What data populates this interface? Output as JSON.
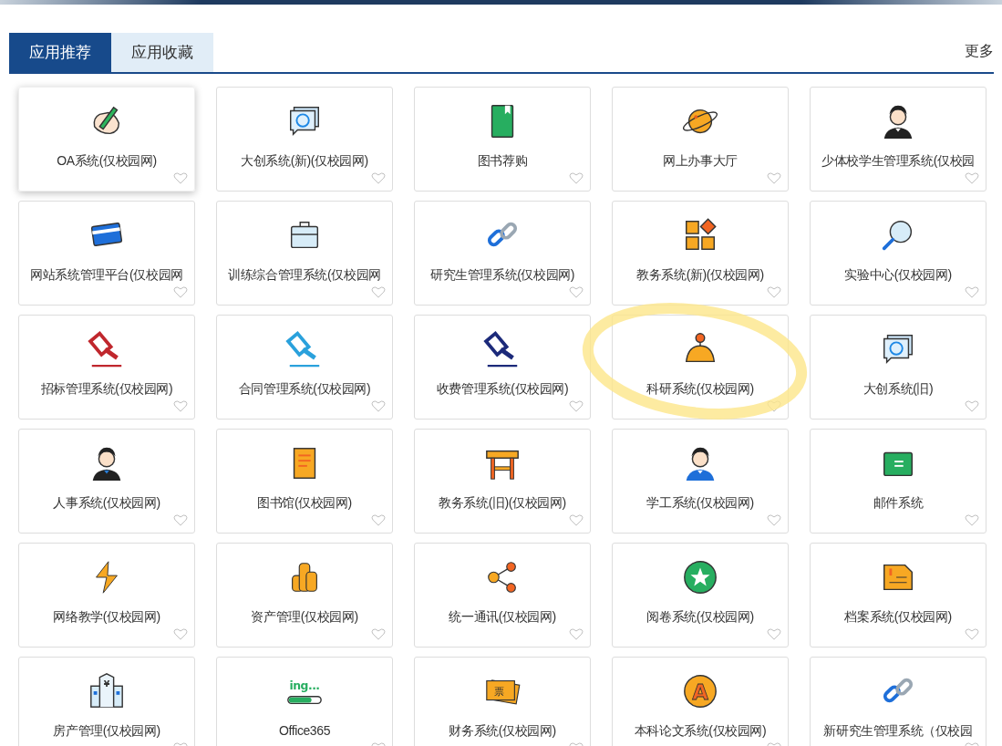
{
  "tabs": [
    {
      "label": "应用推荐",
      "selected": true
    },
    {
      "label": "应用收藏",
      "selected": false
    }
  ],
  "more_link": "更多",
  "apps": [
    {
      "name": "OA系统(仅校园网)",
      "kind": "hand",
      "hovered": true
    },
    {
      "name": "大创系统(新)(仅校园网)",
      "kind": "chat",
      "hovered": false
    },
    {
      "name": "图书荐购",
      "kind": "book",
      "hovered": false
    },
    {
      "name": "网上办事大厅",
      "kind": "planet",
      "hovered": false
    },
    {
      "name": "少体校学生管理系统(仅校园",
      "kind": "person-suit",
      "hovered": false
    },
    {
      "name": "网站系统管理平台(仅校园网",
      "kind": "card",
      "hovered": false
    },
    {
      "name": "训练综合管理系统(仅校园网",
      "kind": "briefcase",
      "hovered": false
    },
    {
      "name": "研究生管理系统(仅校园网)",
      "kind": "link",
      "hovered": false
    },
    {
      "name": "教务系统(新)(仅校园网)",
      "kind": "blocks",
      "hovered": false
    },
    {
      "name": "实验中心(仅校园网)",
      "kind": "magnifier",
      "hovered": false
    },
    {
      "name": "招标管理系统(仅校园网)",
      "kind": "gavel",
      "color": "#c0272d",
      "hovered": false
    },
    {
      "name": "合同管理系统(仅校园网)",
      "kind": "gavel",
      "color": "#2aa1dc",
      "hovered": false
    },
    {
      "name": "收费管理系统(仅校园网)",
      "kind": "gavel",
      "color": "#1c2a7a",
      "hovered": false
    },
    {
      "name": "科研系统(仅校园网)",
      "kind": "joystick",
      "hovered": false
    },
    {
      "name": "大创系统(旧)",
      "kind": "chat",
      "hovered": false
    },
    {
      "name": "人事系统(仅校园网)",
      "kind": "person-bowtie",
      "hovered": false
    },
    {
      "name": "图书馆(仅校园网)",
      "kind": "scroll",
      "hovered": false
    },
    {
      "name": "教务系统(旧)(仅校园网)",
      "kind": "desk",
      "hovered": false
    },
    {
      "name": "学工系统(仅校园网)",
      "kind": "student",
      "hovered": false
    },
    {
      "name": "邮件系统",
      "kind": "board",
      "hovered": false
    },
    {
      "name": "网络教学(仅校园网)",
      "kind": "bolt",
      "hovered": false
    },
    {
      "name": "资产管理(仅校园网)",
      "kind": "coins",
      "hovered": false
    },
    {
      "name": "统一通讯(仅校园网)",
      "kind": "share",
      "hovered": false
    },
    {
      "name": "阅卷系统(仅校园网)",
      "kind": "star",
      "hovered": false
    },
    {
      "name": "档案系统(仅校园网)",
      "kind": "file-alert",
      "hovered": false
    },
    {
      "name": "房产管理(仅校园网)",
      "kind": "building",
      "icon_text": "¥",
      "hovered": false
    },
    {
      "name": "Office365",
      "kind": "progress",
      "icon_text": "ing...",
      "hovered": false
    },
    {
      "name": "财务系统(仅校园网)",
      "kind": "ticket",
      "icon_text": "票",
      "hovered": false
    },
    {
      "name": "本科论文系统(仅校园网)",
      "kind": "letter-badge",
      "icon_text": "A",
      "hovered": false
    },
    {
      "name": "新研究生管理系统（仅校园",
      "kind": "link",
      "hovered": false
    }
  ]
}
